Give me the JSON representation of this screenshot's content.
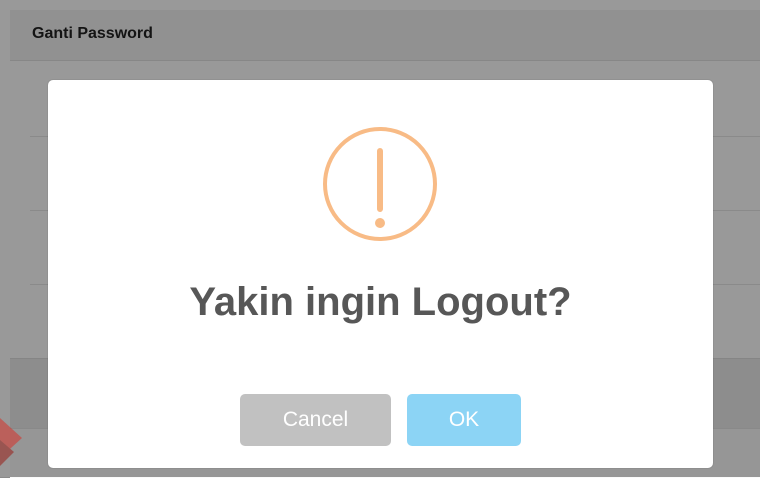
{
  "background": {
    "panel_title": "Ganti Password"
  },
  "dialog": {
    "icon": "warning-exclamation-icon",
    "title": "Yakin ingin Logout?",
    "cancel_label": "Cancel",
    "ok_label": "OK"
  },
  "colors": {
    "icon_stroke": "#f8bb86",
    "title": "#575757",
    "cancel_button": "#c1c1c1",
    "ok_button": "#8cd4f5"
  }
}
